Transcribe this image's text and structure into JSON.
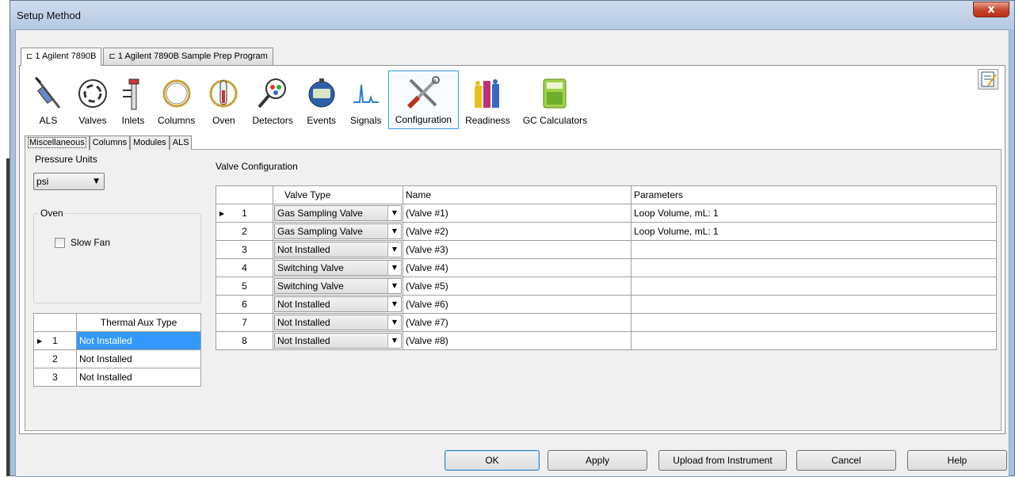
{
  "window": {
    "title": "Setup Method",
    "close_label": "x"
  },
  "top_tabs": [
    {
      "label": "Agilent 7890B",
      "prefix": "1"
    },
    {
      "label": "Agilent 7890B Sample Prep Program",
      "prefix": "1"
    }
  ],
  "toolbar": {
    "items": [
      "ALS",
      "Valves",
      "Inlets",
      "Columns",
      "Oven",
      "Detectors",
      "Events",
      "Signals",
      "Configuration",
      "Readiness",
      "GC Calculators"
    ],
    "active": "Configuration"
  },
  "sub_tabs": [
    "Miscellaneous",
    "Columns",
    "Modules",
    "ALS"
  ],
  "misc": {
    "pressure_units_label": "Pressure Units",
    "pressure_units_value": "psi",
    "oven_group_label": "Oven",
    "slow_fan_label": "Slow Fan",
    "slow_fan_checked": false
  },
  "thermal_aux": {
    "header": "Thermal Aux Type",
    "rows": [
      {
        "num": "1",
        "type": "Not Installed",
        "selected": true
      },
      {
        "num": "2",
        "type": "Not Installed",
        "selected": false
      },
      {
        "num": "3",
        "type": "Not Installed",
        "selected": false
      }
    ]
  },
  "valve_config": {
    "title": "Valve Configuration",
    "headers": {
      "type": "Valve Type",
      "name": "Name",
      "params": "Parameters"
    },
    "rows": [
      {
        "num": "1",
        "type": "Gas Sampling Valve",
        "name": "(Valve #1)",
        "params": "Loop Volume, mL: 1"
      },
      {
        "num": "2",
        "type": "Gas Sampling Valve",
        "name": "(Valve #2)",
        "params": "Loop Volume, mL: 1"
      },
      {
        "num": "3",
        "type": "Not Installed",
        "name": "(Valve #3)",
        "params": ""
      },
      {
        "num": "4",
        "type": "Switching Valve",
        "name": "(Valve #4)",
        "params": ""
      },
      {
        "num": "5",
        "type": "Switching Valve",
        "name": "(Valve #5)",
        "params": ""
      },
      {
        "num": "6",
        "type": "Not Installed",
        "name": "(Valve #6)",
        "params": ""
      },
      {
        "num": "7",
        "type": "Not Installed",
        "name": "(Valve #7)",
        "params": ""
      },
      {
        "num": "8",
        "type": "Not Installed",
        "name": "(Valve #8)",
        "params": ""
      }
    ]
  },
  "buttons": {
    "ok": "OK",
    "apply": "Apply",
    "upload": "Upload from Instrument",
    "cancel": "Cancel",
    "help": "Help"
  }
}
